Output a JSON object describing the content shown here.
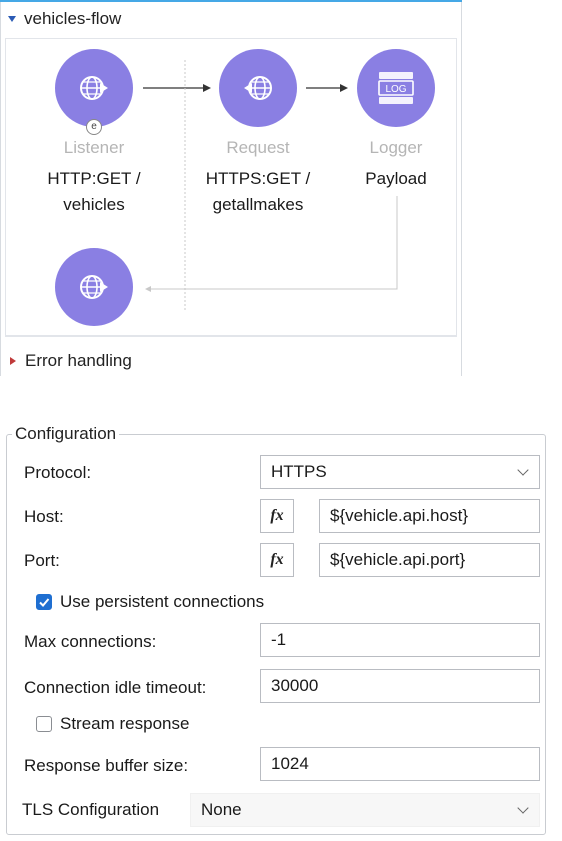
{
  "flow": {
    "title": "vehicles-flow",
    "error_handling_label": "Error handling",
    "nodes": [
      {
        "type": "Listener",
        "config": "HTTP:GET / vehicles",
        "config_line1": "HTTP:GET /",
        "config_line2": "vehicles",
        "icon": "globe-icon"
      },
      {
        "type": "Request",
        "config": "HTTPS:GET / getallmakes",
        "config_line1": "HTTPS:GET /",
        "config_line2": "getallmakes",
        "icon": "globe-icon"
      },
      {
        "type": "Logger",
        "config": "Payload",
        "config_line1": "Payload",
        "icon": "log-icon"
      }
    ],
    "logger_icon_text": "LOG",
    "listener_badge": "e",
    "colors": {
      "node": "#8a7fe3",
      "node_label": "#b5b5b5",
      "accent_line": "#45a8e6",
      "error_triangle": "#c03a3a"
    }
  },
  "config": {
    "title": "Configuration",
    "protocol": {
      "label": "Protocol:",
      "value": "HTTPS"
    },
    "host": {
      "label": "Host:",
      "value": "${vehicle.api.host}",
      "fx": "fx"
    },
    "port": {
      "label": "Port:",
      "value": "${vehicle.api.port}",
      "fx": "fx"
    },
    "persistent": {
      "label": "Use persistent connections",
      "checked": true
    },
    "max_connections": {
      "label": "Max connections:",
      "value": "-1"
    },
    "idle_timeout": {
      "label": "Connection idle timeout:",
      "value": "30000"
    },
    "stream_response": {
      "label": "Stream response",
      "checked": false
    },
    "buffer_size": {
      "label": "Response buffer size:",
      "value": "1024"
    },
    "tls": {
      "label": "TLS Configuration",
      "value": "None"
    }
  }
}
